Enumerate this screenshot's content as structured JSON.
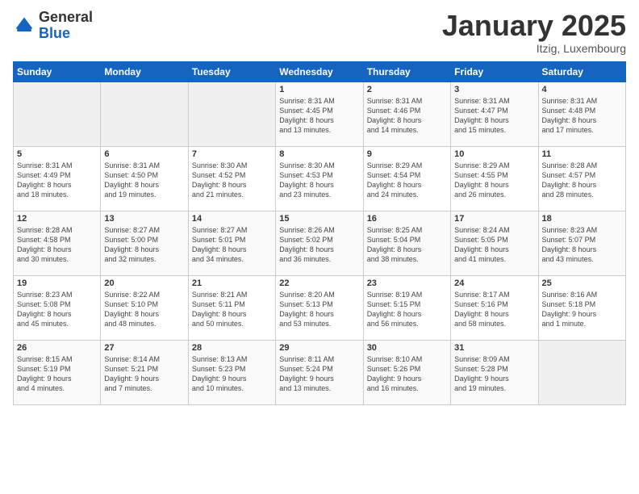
{
  "logo": {
    "general": "General",
    "blue": "Blue"
  },
  "header": {
    "title": "January 2025",
    "subtitle": "Itzig, Luxembourg"
  },
  "calendar": {
    "headers": [
      "Sunday",
      "Monday",
      "Tuesday",
      "Wednesday",
      "Thursday",
      "Friday",
      "Saturday"
    ],
    "weeks": [
      [
        {
          "day": "",
          "info": ""
        },
        {
          "day": "",
          "info": ""
        },
        {
          "day": "",
          "info": ""
        },
        {
          "day": "1",
          "info": "Sunrise: 8:31 AM\nSunset: 4:45 PM\nDaylight: 8 hours\nand 13 minutes."
        },
        {
          "day": "2",
          "info": "Sunrise: 8:31 AM\nSunset: 4:46 PM\nDaylight: 8 hours\nand 14 minutes."
        },
        {
          "day": "3",
          "info": "Sunrise: 8:31 AM\nSunset: 4:47 PM\nDaylight: 8 hours\nand 15 minutes."
        },
        {
          "day": "4",
          "info": "Sunrise: 8:31 AM\nSunset: 4:48 PM\nDaylight: 8 hours\nand 17 minutes."
        }
      ],
      [
        {
          "day": "5",
          "info": "Sunrise: 8:31 AM\nSunset: 4:49 PM\nDaylight: 8 hours\nand 18 minutes."
        },
        {
          "day": "6",
          "info": "Sunrise: 8:31 AM\nSunset: 4:50 PM\nDaylight: 8 hours\nand 19 minutes."
        },
        {
          "day": "7",
          "info": "Sunrise: 8:30 AM\nSunset: 4:52 PM\nDaylight: 8 hours\nand 21 minutes."
        },
        {
          "day": "8",
          "info": "Sunrise: 8:30 AM\nSunset: 4:53 PM\nDaylight: 8 hours\nand 23 minutes."
        },
        {
          "day": "9",
          "info": "Sunrise: 8:29 AM\nSunset: 4:54 PM\nDaylight: 8 hours\nand 24 minutes."
        },
        {
          "day": "10",
          "info": "Sunrise: 8:29 AM\nSunset: 4:55 PM\nDaylight: 8 hours\nand 26 minutes."
        },
        {
          "day": "11",
          "info": "Sunrise: 8:28 AM\nSunset: 4:57 PM\nDaylight: 8 hours\nand 28 minutes."
        }
      ],
      [
        {
          "day": "12",
          "info": "Sunrise: 8:28 AM\nSunset: 4:58 PM\nDaylight: 8 hours\nand 30 minutes."
        },
        {
          "day": "13",
          "info": "Sunrise: 8:27 AM\nSunset: 5:00 PM\nDaylight: 8 hours\nand 32 minutes."
        },
        {
          "day": "14",
          "info": "Sunrise: 8:27 AM\nSunset: 5:01 PM\nDaylight: 8 hours\nand 34 minutes."
        },
        {
          "day": "15",
          "info": "Sunrise: 8:26 AM\nSunset: 5:02 PM\nDaylight: 8 hours\nand 36 minutes."
        },
        {
          "day": "16",
          "info": "Sunrise: 8:25 AM\nSunset: 5:04 PM\nDaylight: 8 hours\nand 38 minutes."
        },
        {
          "day": "17",
          "info": "Sunrise: 8:24 AM\nSunset: 5:05 PM\nDaylight: 8 hours\nand 41 minutes."
        },
        {
          "day": "18",
          "info": "Sunrise: 8:23 AM\nSunset: 5:07 PM\nDaylight: 8 hours\nand 43 minutes."
        }
      ],
      [
        {
          "day": "19",
          "info": "Sunrise: 8:23 AM\nSunset: 5:08 PM\nDaylight: 8 hours\nand 45 minutes."
        },
        {
          "day": "20",
          "info": "Sunrise: 8:22 AM\nSunset: 5:10 PM\nDaylight: 8 hours\nand 48 minutes."
        },
        {
          "day": "21",
          "info": "Sunrise: 8:21 AM\nSunset: 5:11 PM\nDaylight: 8 hours\nand 50 minutes."
        },
        {
          "day": "22",
          "info": "Sunrise: 8:20 AM\nSunset: 5:13 PM\nDaylight: 8 hours\nand 53 minutes."
        },
        {
          "day": "23",
          "info": "Sunrise: 8:19 AM\nSunset: 5:15 PM\nDaylight: 8 hours\nand 56 minutes."
        },
        {
          "day": "24",
          "info": "Sunrise: 8:17 AM\nSunset: 5:16 PM\nDaylight: 8 hours\nand 58 minutes."
        },
        {
          "day": "25",
          "info": "Sunrise: 8:16 AM\nSunset: 5:18 PM\nDaylight: 9 hours\nand 1 minute."
        }
      ],
      [
        {
          "day": "26",
          "info": "Sunrise: 8:15 AM\nSunset: 5:19 PM\nDaylight: 9 hours\nand 4 minutes."
        },
        {
          "day": "27",
          "info": "Sunrise: 8:14 AM\nSunset: 5:21 PM\nDaylight: 9 hours\nand 7 minutes."
        },
        {
          "day": "28",
          "info": "Sunrise: 8:13 AM\nSunset: 5:23 PM\nDaylight: 9 hours\nand 10 minutes."
        },
        {
          "day": "29",
          "info": "Sunrise: 8:11 AM\nSunset: 5:24 PM\nDaylight: 9 hours\nand 13 minutes."
        },
        {
          "day": "30",
          "info": "Sunrise: 8:10 AM\nSunset: 5:26 PM\nDaylight: 9 hours\nand 16 minutes."
        },
        {
          "day": "31",
          "info": "Sunrise: 8:09 AM\nSunset: 5:28 PM\nDaylight: 9 hours\nand 19 minutes."
        },
        {
          "day": "",
          "info": ""
        }
      ]
    ]
  }
}
